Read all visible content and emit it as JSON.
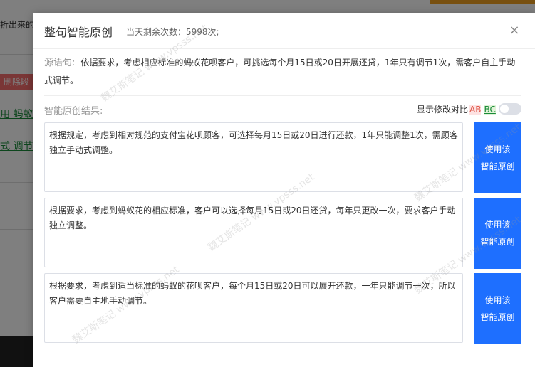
{
  "background": {
    "top_left_text": "折出来的",
    "delete_paragraph": "删除段落",
    "green_text_1": "用 蚂蚁",
    "green_text_2": "式 调节。"
  },
  "modal": {
    "title": "整句智能原创",
    "remaining": "当天剩余次数：5998次;",
    "close_icon": "×",
    "source_label": "源语句:",
    "source_text": "依据要求，考虑相应标准的蚂蚁花呗客户，可挑选每个月15日或20日开展还贷，1年只有调节1次，需客户自主手动式调节。",
    "result_label": "智能原创结果:",
    "diff_label": "显示修改对比",
    "diff_ab": "AB",
    "diff_bc": "BC",
    "diff_toggle_on": false,
    "results": [
      {
        "text": "根据规定，考虑到相对规范的支付宝花呗顾客，可选择每月15日或20日进行还款，1年只能调整1次，需顾客独立手动式调整。",
        "button_line1": "使用该",
        "button_line2": "智能原创"
      },
      {
        "text": "根据要求，考虑到蚂蚁花的相应标准，客户可以选择每月15日或20日还贷，每年只更改一次，要求客户手动独立调整。",
        "button_line1": "使用该",
        "button_line2": "智能原创"
      },
      {
        "text": "根据要求，考虑到适当标准的蚂蚁的花呗客户，每个月15日或20日可以展开还款，一年只能调节一次，所以客户需要自主地手动调节。",
        "button_line1": "使用该",
        "button_line2": "智能原创"
      }
    ]
  },
  "watermark": {
    "line1": "魏艾斯笔记",
    "line2": "www.vpsss.net"
  },
  "colors": {
    "primary_button": "#1e6fff",
    "diff_removed": "#e0584a",
    "diff_added": "#1a8c3a"
  }
}
